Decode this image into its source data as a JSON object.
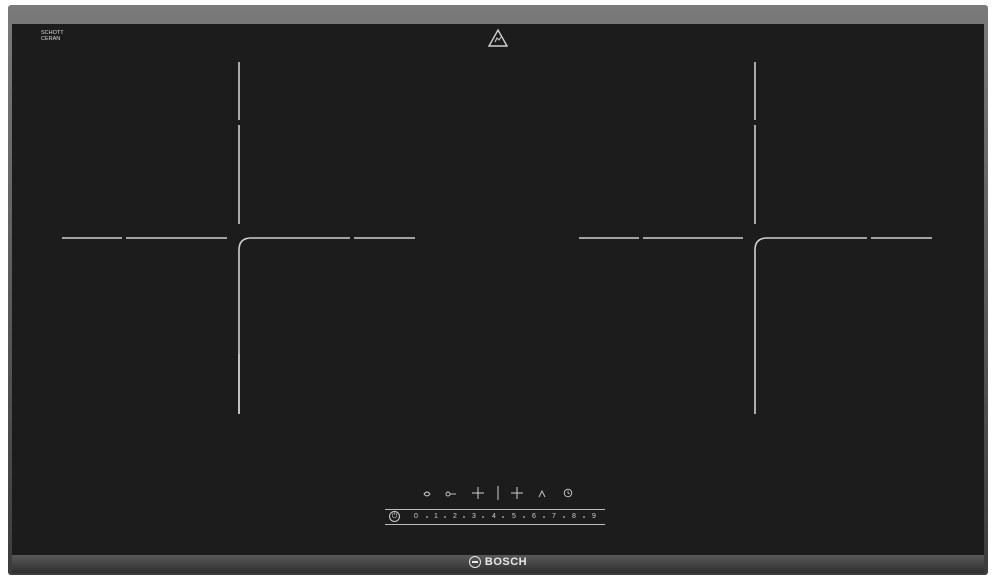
{
  "brand": {
    "name": "BOSCH"
  },
  "glass_maker": {
    "line1": "SCHOTT",
    "line2": "CERAN",
    "line3": ""
  },
  "icons": {
    "warning": "warning-triangle-icon",
    "cooking_zones": [
      "zone-left-cross",
      "zone-right-cross"
    ],
    "controls": [
      "pan-icon",
      "key-lock-icon",
      "plus-left-icon",
      "divider",
      "plus-right-icon",
      "zone-select-icon",
      "timer-icon"
    ]
  },
  "controls": {
    "power_symbol": "⏻",
    "power_levels": [
      "0",
      "1",
      "2",
      "3",
      "4",
      "5",
      "6",
      "7",
      "8",
      "9"
    ]
  },
  "colors": {
    "glass": "#1c1c1c",
    "frame": "#5a5a5a",
    "markings": "#d0d0d0"
  }
}
